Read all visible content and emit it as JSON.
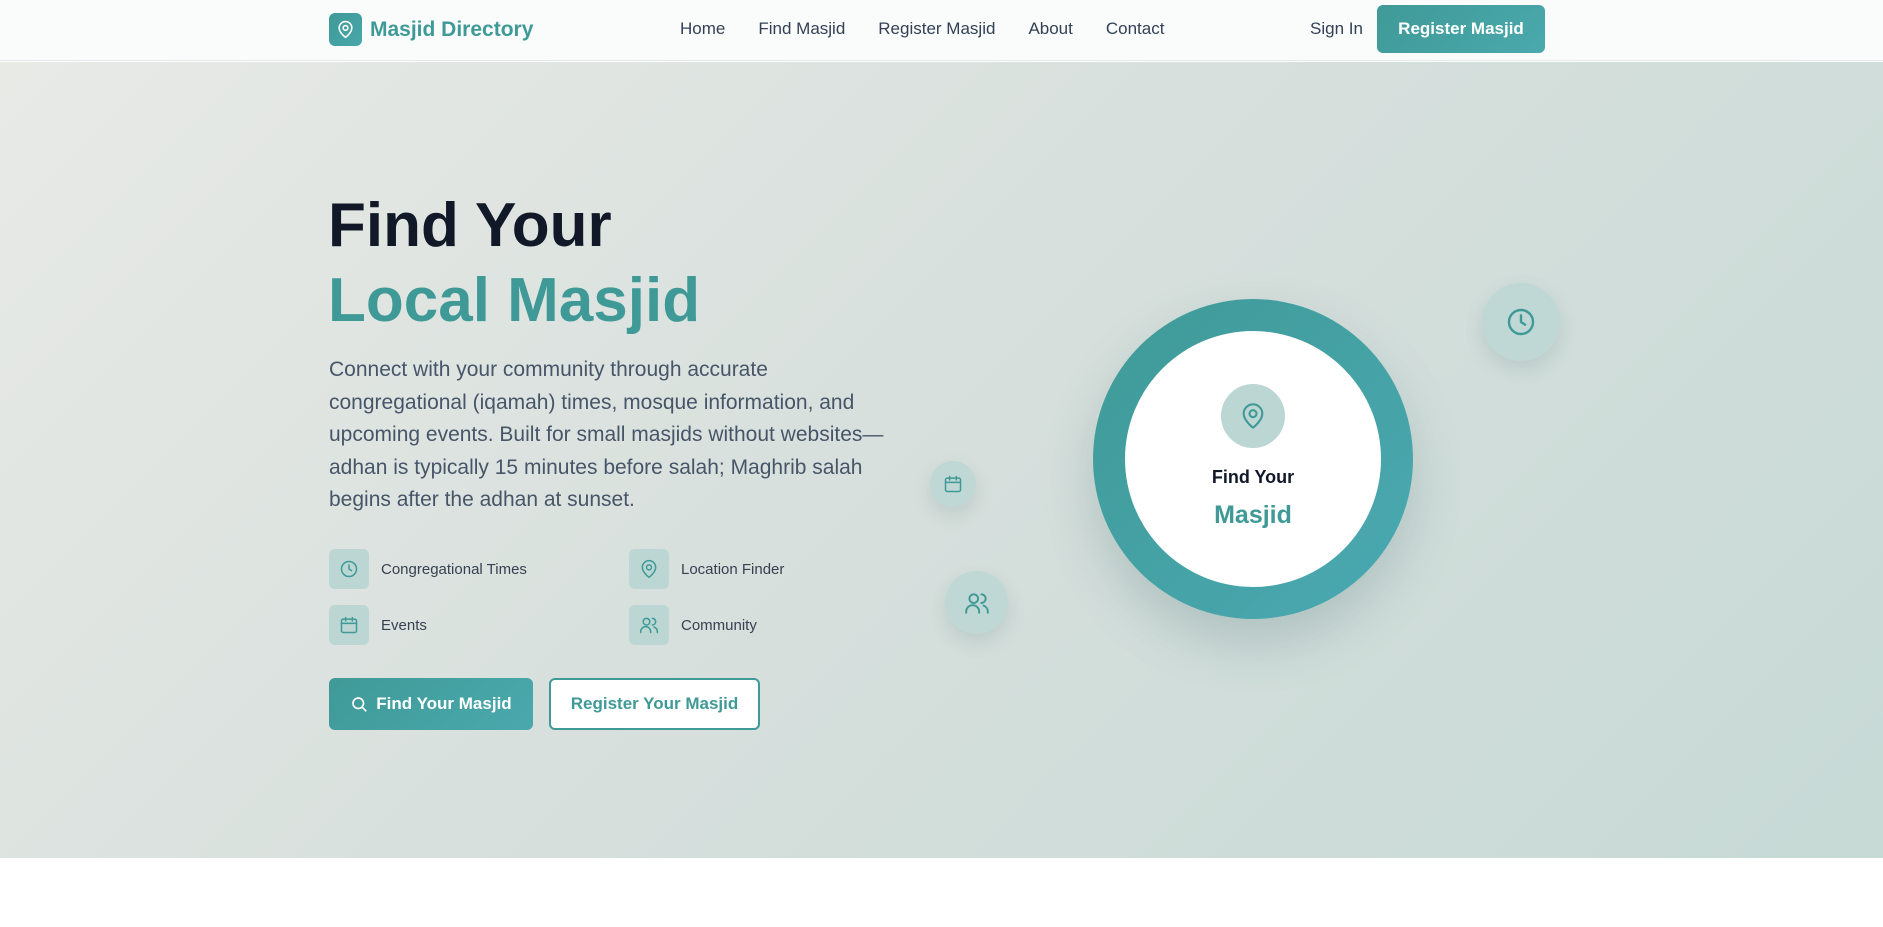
{
  "header": {
    "logo_text": "Masjid Directory",
    "logo_icon": "map-pin-icon",
    "nav": [
      {
        "label": "Home"
      },
      {
        "label": "Find Masjid"
      },
      {
        "label": "Register Masjid"
      },
      {
        "label": "About"
      },
      {
        "label": "Contact"
      }
    ],
    "sign_in": "Sign In",
    "register_button": "Register Masjid"
  },
  "hero": {
    "title_line1": "Find Your",
    "title_line2": "Local Masjid",
    "description": "Connect with your community through accurate congregational (iqamah) times, mosque information, and upcoming events. Built for small masjids without websites—adhan is typically 15 minutes before salah; Maghrib salah begins after the adhan at sunset.",
    "features": [
      {
        "label": "Congregational Times",
        "icon": "clock-icon"
      },
      {
        "label": "Location Finder",
        "icon": "map-pin-icon"
      },
      {
        "label": "Events",
        "icon": "calendar-icon"
      },
      {
        "label": "Community",
        "icon": "users-icon"
      }
    ],
    "primary_button": "Find Your Masjid",
    "secondary_button": "Register Your Masjid",
    "circle": {
      "line1": "Find Your",
      "line2": "Masjid"
    }
  },
  "colors": {
    "accent": "#3f9a97",
    "accent_light": "#bcd6d3",
    "heading": "#111827",
    "body_text": "#475569"
  }
}
